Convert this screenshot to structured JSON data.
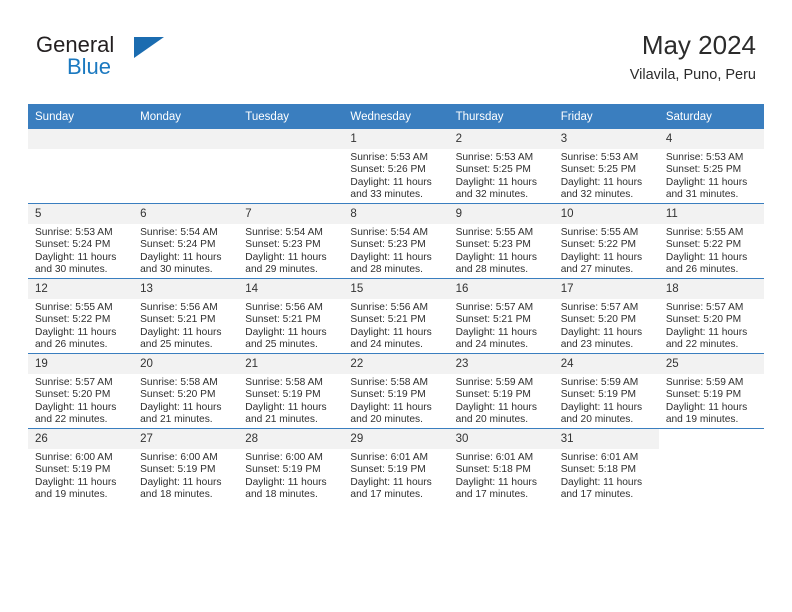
{
  "brand": {
    "name_top": "General",
    "name_bottom": "Blue",
    "accent_color": "#1b6cb0"
  },
  "header": {
    "title": "May 2024",
    "subtitle": "Vilavila, Puno, Peru"
  },
  "calendar": {
    "header_color": "#3a7ebf",
    "daynum_band_color": "#f2f2f2",
    "weekday_headers": [
      "Sunday",
      "Monday",
      "Tuesday",
      "Wednesday",
      "Thursday",
      "Friday",
      "Saturday"
    ],
    "weeks": [
      [
        {
          "day": "",
          "blank": true
        },
        {
          "day": "",
          "blank": true
        },
        {
          "day": "",
          "blank": true
        },
        {
          "day": "1",
          "sunrise": "Sunrise: 5:53 AM",
          "sunset": "Sunset: 5:26 PM",
          "daylight": "Daylight: 11 hours and 33 minutes."
        },
        {
          "day": "2",
          "sunrise": "Sunrise: 5:53 AM",
          "sunset": "Sunset: 5:25 PM",
          "daylight": "Daylight: 11 hours and 32 minutes."
        },
        {
          "day": "3",
          "sunrise": "Sunrise: 5:53 AM",
          "sunset": "Sunset: 5:25 PM",
          "daylight": "Daylight: 11 hours and 32 minutes."
        },
        {
          "day": "4",
          "sunrise": "Sunrise: 5:53 AM",
          "sunset": "Sunset: 5:25 PM",
          "daylight": "Daylight: 11 hours and 31 minutes."
        }
      ],
      [
        {
          "day": "5",
          "sunrise": "Sunrise: 5:53 AM",
          "sunset": "Sunset: 5:24 PM",
          "daylight": "Daylight: 11 hours and 30 minutes."
        },
        {
          "day": "6",
          "sunrise": "Sunrise: 5:54 AM",
          "sunset": "Sunset: 5:24 PM",
          "daylight": "Daylight: 11 hours and 30 minutes."
        },
        {
          "day": "7",
          "sunrise": "Sunrise: 5:54 AM",
          "sunset": "Sunset: 5:23 PM",
          "daylight": "Daylight: 11 hours and 29 minutes."
        },
        {
          "day": "8",
          "sunrise": "Sunrise: 5:54 AM",
          "sunset": "Sunset: 5:23 PM",
          "daylight": "Daylight: 11 hours and 28 minutes."
        },
        {
          "day": "9",
          "sunrise": "Sunrise: 5:55 AM",
          "sunset": "Sunset: 5:23 PM",
          "daylight": "Daylight: 11 hours and 28 minutes."
        },
        {
          "day": "10",
          "sunrise": "Sunrise: 5:55 AM",
          "sunset": "Sunset: 5:22 PM",
          "daylight": "Daylight: 11 hours and 27 minutes."
        },
        {
          "day": "11",
          "sunrise": "Sunrise: 5:55 AM",
          "sunset": "Sunset: 5:22 PM",
          "daylight": "Daylight: 11 hours and 26 minutes."
        }
      ],
      [
        {
          "day": "12",
          "sunrise": "Sunrise: 5:55 AM",
          "sunset": "Sunset: 5:22 PM",
          "daylight": "Daylight: 11 hours and 26 minutes."
        },
        {
          "day": "13",
          "sunrise": "Sunrise: 5:56 AM",
          "sunset": "Sunset: 5:21 PM",
          "daylight": "Daylight: 11 hours and 25 minutes."
        },
        {
          "day": "14",
          "sunrise": "Sunrise: 5:56 AM",
          "sunset": "Sunset: 5:21 PM",
          "daylight": "Daylight: 11 hours and 25 minutes."
        },
        {
          "day": "15",
          "sunrise": "Sunrise: 5:56 AM",
          "sunset": "Sunset: 5:21 PM",
          "daylight": "Daylight: 11 hours and 24 minutes."
        },
        {
          "day": "16",
          "sunrise": "Sunrise: 5:57 AM",
          "sunset": "Sunset: 5:21 PM",
          "daylight": "Daylight: 11 hours and 24 minutes."
        },
        {
          "day": "17",
          "sunrise": "Sunrise: 5:57 AM",
          "sunset": "Sunset: 5:20 PM",
          "daylight": "Daylight: 11 hours and 23 minutes."
        },
        {
          "day": "18",
          "sunrise": "Sunrise: 5:57 AM",
          "sunset": "Sunset: 5:20 PM",
          "daylight": "Daylight: 11 hours and 22 minutes."
        }
      ],
      [
        {
          "day": "19",
          "sunrise": "Sunrise: 5:57 AM",
          "sunset": "Sunset: 5:20 PM",
          "daylight": "Daylight: 11 hours and 22 minutes."
        },
        {
          "day": "20",
          "sunrise": "Sunrise: 5:58 AM",
          "sunset": "Sunset: 5:20 PM",
          "daylight": "Daylight: 11 hours and 21 minutes."
        },
        {
          "day": "21",
          "sunrise": "Sunrise: 5:58 AM",
          "sunset": "Sunset: 5:19 PM",
          "daylight": "Daylight: 11 hours and 21 minutes."
        },
        {
          "day": "22",
          "sunrise": "Sunrise: 5:58 AM",
          "sunset": "Sunset: 5:19 PM",
          "daylight": "Daylight: 11 hours and 20 minutes."
        },
        {
          "day": "23",
          "sunrise": "Sunrise: 5:59 AM",
          "sunset": "Sunset: 5:19 PM",
          "daylight": "Daylight: 11 hours and 20 minutes."
        },
        {
          "day": "24",
          "sunrise": "Sunrise: 5:59 AM",
          "sunset": "Sunset: 5:19 PM",
          "daylight": "Daylight: 11 hours and 20 minutes."
        },
        {
          "day": "25",
          "sunrise": "Sunrise: 5:59 AM",
          "sunset": "Sunset: 5:19 PM",
          "daylight": "Daylight: 11 hours and 19 minutes."
        }
      ],
      [
        {
          "day": "26",
          "sunrise": "Sunrise: 6:00 AM",
          "sunset": "Sunset: 5:19 PM",
          "daylight": "Daylight: 11 hours and 19 minutes."
        },
        {
          "day": "27",
          "sunrise": "Sunrise: 6:00 AM",
          "sunset": "Sunset: 5:19 PM",
          "daylight": "Daylight: 11 hours and 18 minutes."
        },
        {
          "day": "28",
          "sunrise": "Sunrise: 6:00 AM",
          "sunset": "Sunset: 5:19 PM",
          "daylight": "Daylight: 11 hours and 18 minutes."
        },
        {
          "day": "29",
          "sunrise": "Sunrise: 6:01 AM",
          "sunset": "Sunset: 5:19 PM",
          "daylight": "Daylight: 11 hours and 17 minutes."
        },
        {
          "day": "30",
          "sunrise": "Sunrise: 6:01 AM",
          "sunset": "Sunset: 5:18 PM",
          "daylight": "Daylight: 11 hours and 17 minutes."
        },
        {
          "day": "31",
          "sunrise": "Sunrise: 6:01 AM",
          "sunset": "Sunset: 5:18 PM",
          "daylight": "Daylight: 11 hours and 17 minutes."
        },
        {
          "day": "",
          "blank": true
        }
      ]
    ]
  }
}
